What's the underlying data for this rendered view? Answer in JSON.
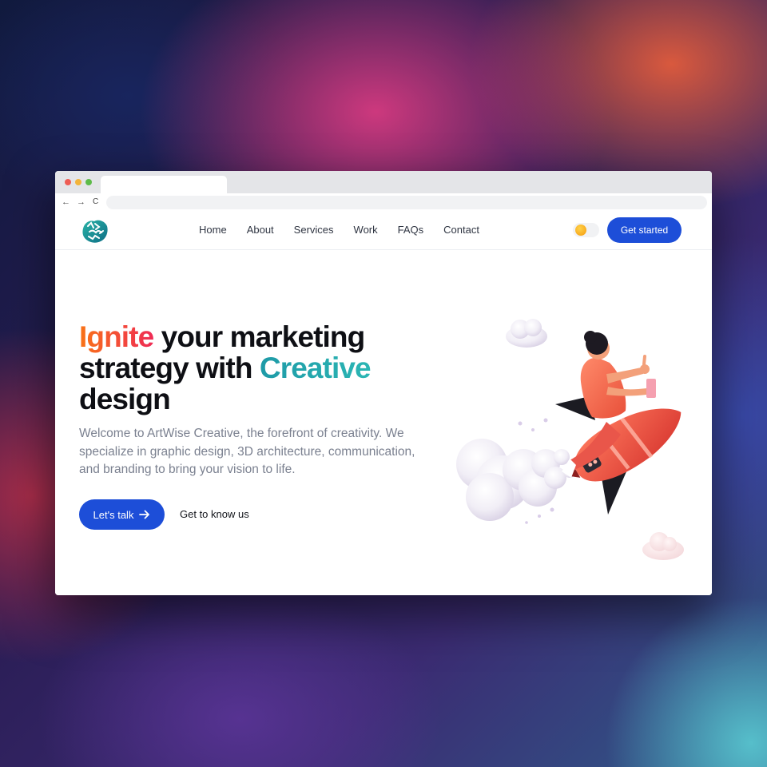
{
  "browser": {
    "back_icon": "←",
    "forward_icon": "→",
    "reload_icon": "C"
  },
  "header": {
    "logo_name": "artwise-logo",
    "nav": [
      "Home",
      "About",
      "Services",
      "Work",
      "FAQs",
      "Contact"
    ],
    "cta_label": "Get started"
  },
  "hero": {
    "title_accent1": "Ignite",
    "title_mid1": " your marketing strategy with ",
    "title_accent2": "Creative",
    "title_end": " design",
    "subtitle": "Welcome to ArtWise Creative, the forefront of creativity. We specialize in graphic design, 3D architecture, communication, and branding to bring your vision to life.",
    "primary_button": "Let's talk",
    "secondary_button": "Get to know us"
  },
  "colors": {
    "brand": "#1d4ed8",
    "accent_orange": "#f97316",
    "accent_teal": "#1e9aa7"
  },
  "icons": {
    "arrow": "arrow-right-icon",
    "theme": "sun-icon"
  }
}
